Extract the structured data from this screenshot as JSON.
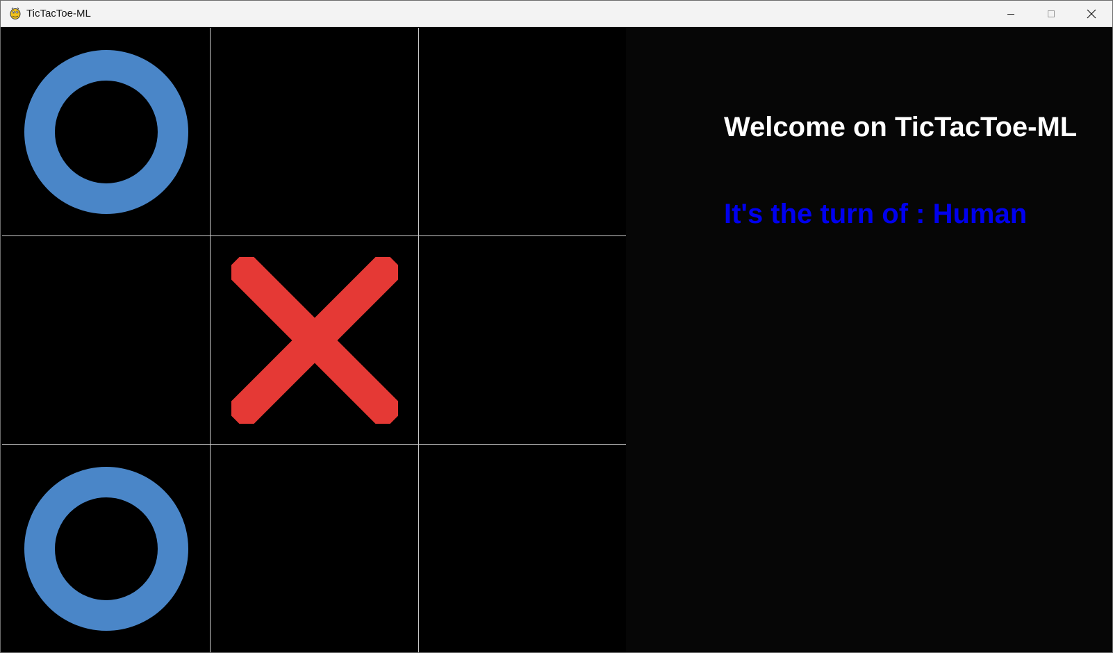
{
  "window": {
    "title": "TicTacToe-ML",
    "icon": "pygame-snake-icon",
    "controls": [
      "minimize-icon",
      "maximize-icon",
      "close-icon"
    ]
  },
  "board": {
    "cells": [
      "O",
      "",
      "",
      "",
      "X",
      "",
      "O",
      "",
      ""
    ],
    "colors": {
      "O": "#4a86c8",
      "X": "#e53935",
      "gridline": "#cfcfcf",
      "background": "#000000"
    }
  },
  "panel": {
    "welcome": "Welcome on TicTacToe-ML",
    "turn": "It's the turn of : Human",
    "colors": {
      "welcome": "#ffffff",
      "turn": "#0000ee",
      "background": "#060606"
    }
  }
}
